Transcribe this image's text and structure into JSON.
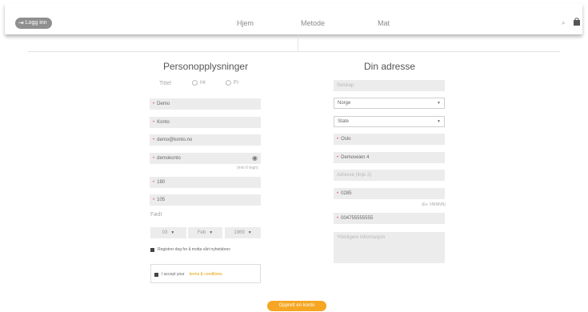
{
  "header": {
    "login_label": "Logg inn",
    "nav": [
      "Hjem",
      "Metode",
      "Mat"
    ],
    "icons": [
      "login-icon",
      "search-icon",
      "shopping-bag-icon"
    ]
  },
  "personal": {
    "heading": "Personopplysninger",
    "title_label": "Tittel",
    "title_options": [
      "Hr",
      "Fr"
    ],
    "first_name": "Demo",
    "last_name": "Konto",
    "email": "demo@konto.no",
    "password": "demokonto",
    "password_hint": "(min 6 tegn)",
    "height": "180",
    "weight": "105",
    "birth_label": "Født",
    "birth_day": "03",
    "birth_month": "Feb",
    "birth_year": "1969",
    "newsletter_label": "Registrer deg for å motta vårt nyhetsbrev",
    "accept_prefix": "I accept your",
    "accept_link": "terms & conditions"
  },
  "address": {
    "heading": "Din adresse",
    "company_placeholder": "Selskap",
    "country": "Norge",
    "state": "State",
    "city": "Oslo",
    "address1": "Demoveien 4",
    "address2_placeholder": "Adresse (linje 2)",
    "postal_code": "0285",
    "postal_hint": "(Ex: NNNNN)",
    "phone": "004755555555",
    "info_placeholder": "Ytterligere informasjon"
  },
  "submit_label": "Opprett en konto",
  "colors": {
    "accent": "#f6a622",
    "required": "#e86060",
    "link": "#e0a100"
  }
}
